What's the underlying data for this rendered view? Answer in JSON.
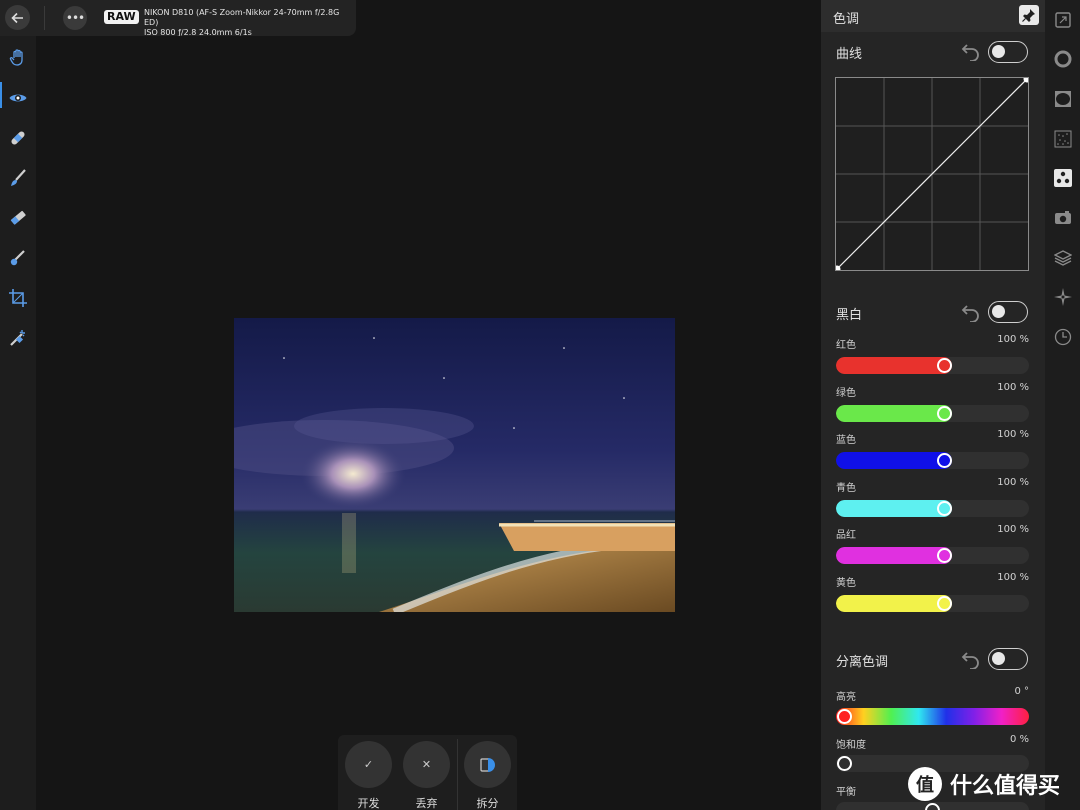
{
  "topbar": {
    "more_label": "•••",
    "raw_badge": "RAW",
    "camera_line1": "NIKON D810 (AF-S Zoom-Nikkor 24-70mm f/2.8G ED)",
    "camera_line2": "ISO 800 ƒ/2.8 24.0mm 6/1s"
  },
  "left_tools": [
    "hand-icon",
    "eye-icon",
    "bandage-icon",
    "brush-icon",
    "eraser-icon",
    "dropper-brush-icon",
    "crop-icon",
    "wand-icon"
  ],
  "bottom": {
    "develop_icon": "✓",
    "develop_label": "开发",
    "discard_icon": "✕",
    "discard_label": "丢弃",
    "split_label": "拆分"
  },
  "panel": {
    "title": "色调",
    "curves": {
      "title": "曲线",
      "enabled": false
    },
    "bw": {
      "title": "黑白",
      "enabled": false,
      "sliders": [
        {
          "label": "红色",
          "value": "100 %",
          "fraction": 0.6,
          "color": "#e8322d"
        },
        {
          "label": "绿色",
          "value": "100 %",
          "fraction": 0.6,
          "color": "#6ae84a"
        },
        {
          "label": "蓝色",
          "value": "100 %",
          "fraction": 0.6,
          "color": "#1010e8"
        },
        {
          "label": "青色",
          "value": "100 %",
          "fraction": 0.6,
          "color": "#5ef0f0"
        },
        {
          "label": "品红",
          "value": "100 %",
          "fraction": 0.6,
          "color": "#e030e0"
        },
        {
          "label": "黄色",
          "value": "100 %",
          "fraction": 0.6,
          "color": "#f2f24a"
        }
      ]
    },
    "split_tone": {
      "title": "分离色调",
      "enabled": false,
      "highlight_label": "高亮",
      "highlight_value": "0 °",
      "saturation_label": "饱和度",
      "saturation_value": "0 %",
      "balance_label": "平衡"
    }
  },
  "right_tools": [
    "expand-icon",
    "color-wheel-icon",
    "vignette-icon",
    "noise-icon",
    "tone-icon",
    "camera-icon",
    "layers-icon",
    "compass-icon",
    "history-icon"
  ],
  "watermark": {
    "logo": "值",
    "text": "什么值得买"
  }
}
